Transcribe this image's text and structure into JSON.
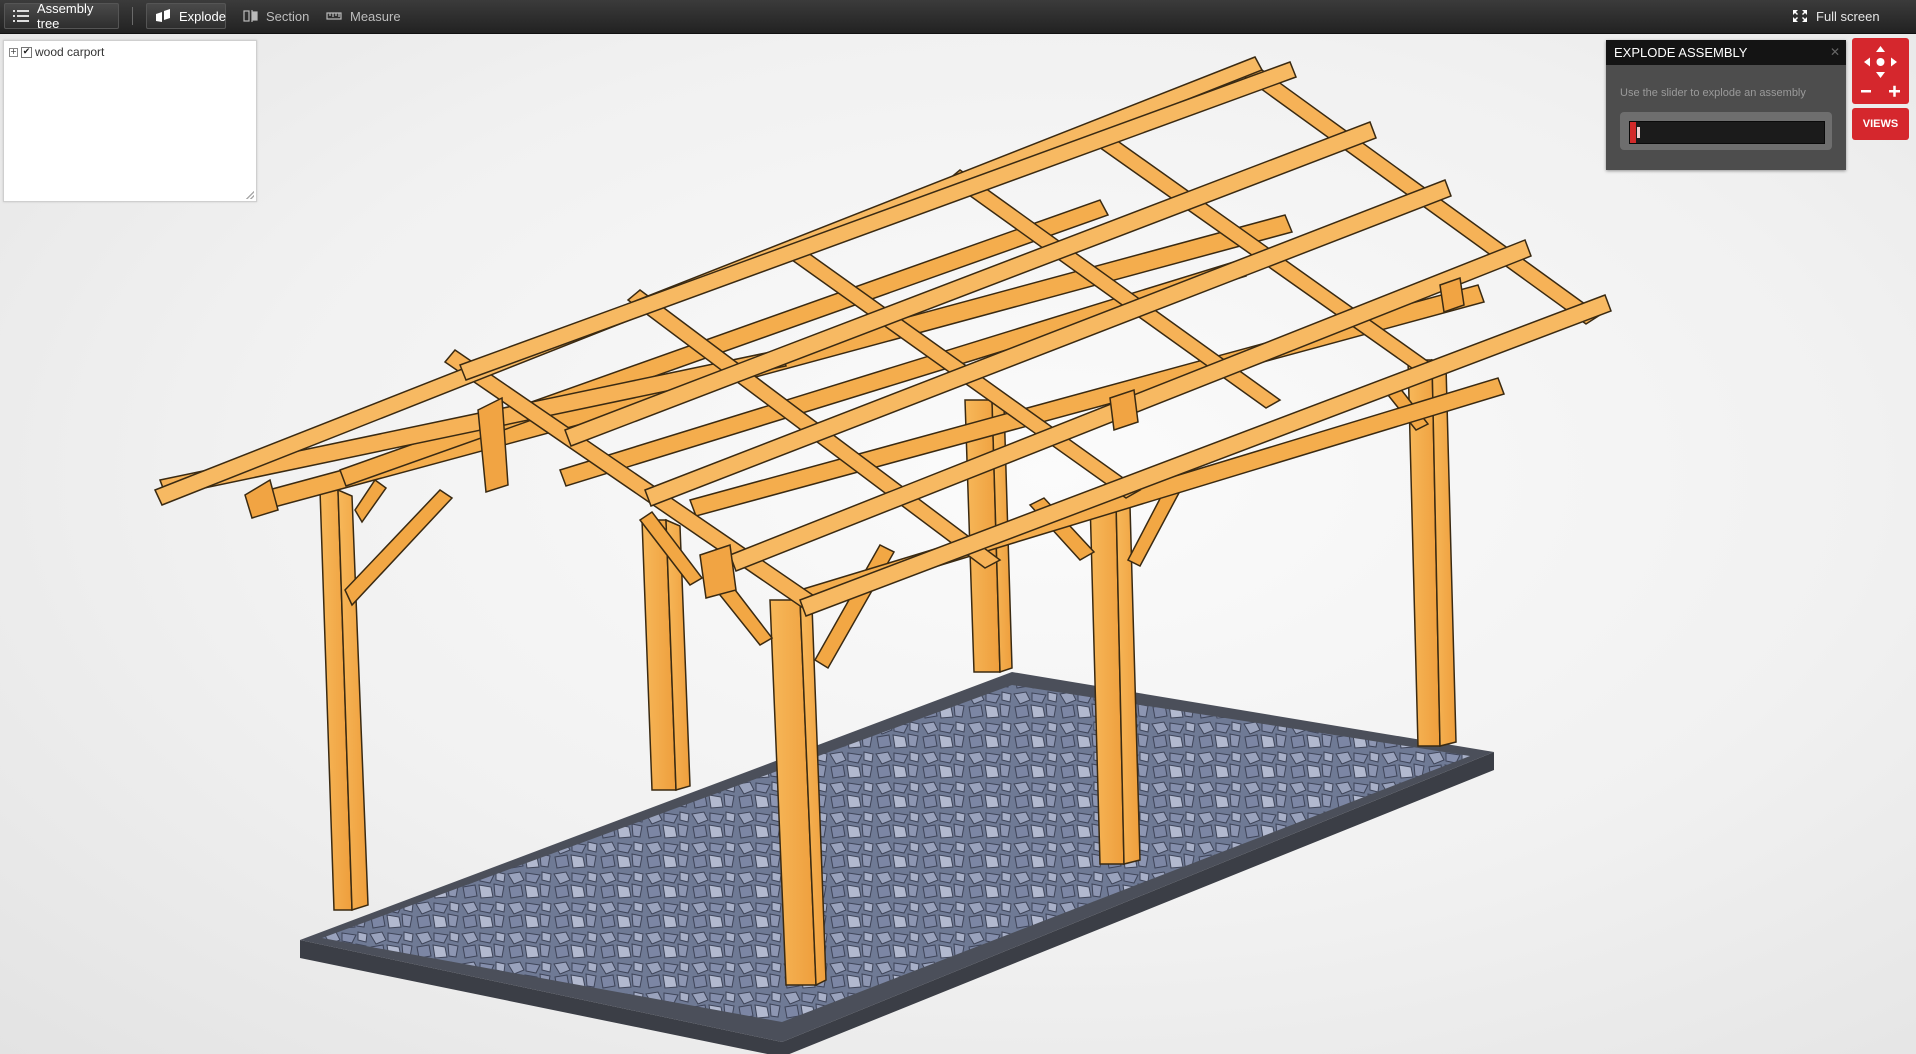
{
  "toolbar": {
    "assembly_tree": "Assembly tree",
    "explode": "Explode",
    "section": "Section",
    "measure": "Measure",
    "full_screen": "Full screen"
  },
  "tree": {
    "items": [
      {
        "label": "wood carport",
        "checked": true,
        "expander": "+"
      }
    ]
  },
  "explode_panel": {
    "title": "EXPLODE ASSEMBLY",
    "hint": "Use the slider to explode an assembly",
    "slider_value": 0.03
  },
  "nav": {
    "views_label": "VIEWS",
    "icons": [
      "pan-up-icon",
      "pan-down-icon",
      "pan-left-icon",
      "pan-right-icon",
      "zoom-out-icon",
      "zoom-in-icon"
    ]
  },
  "colors": {
    "accent": "#d5272d",
    "wood": "#f3a948",
    "wood_dark": "#b8741f",
    "gravel": "#6f7a95",
    "base": "#444750"
  }
}
